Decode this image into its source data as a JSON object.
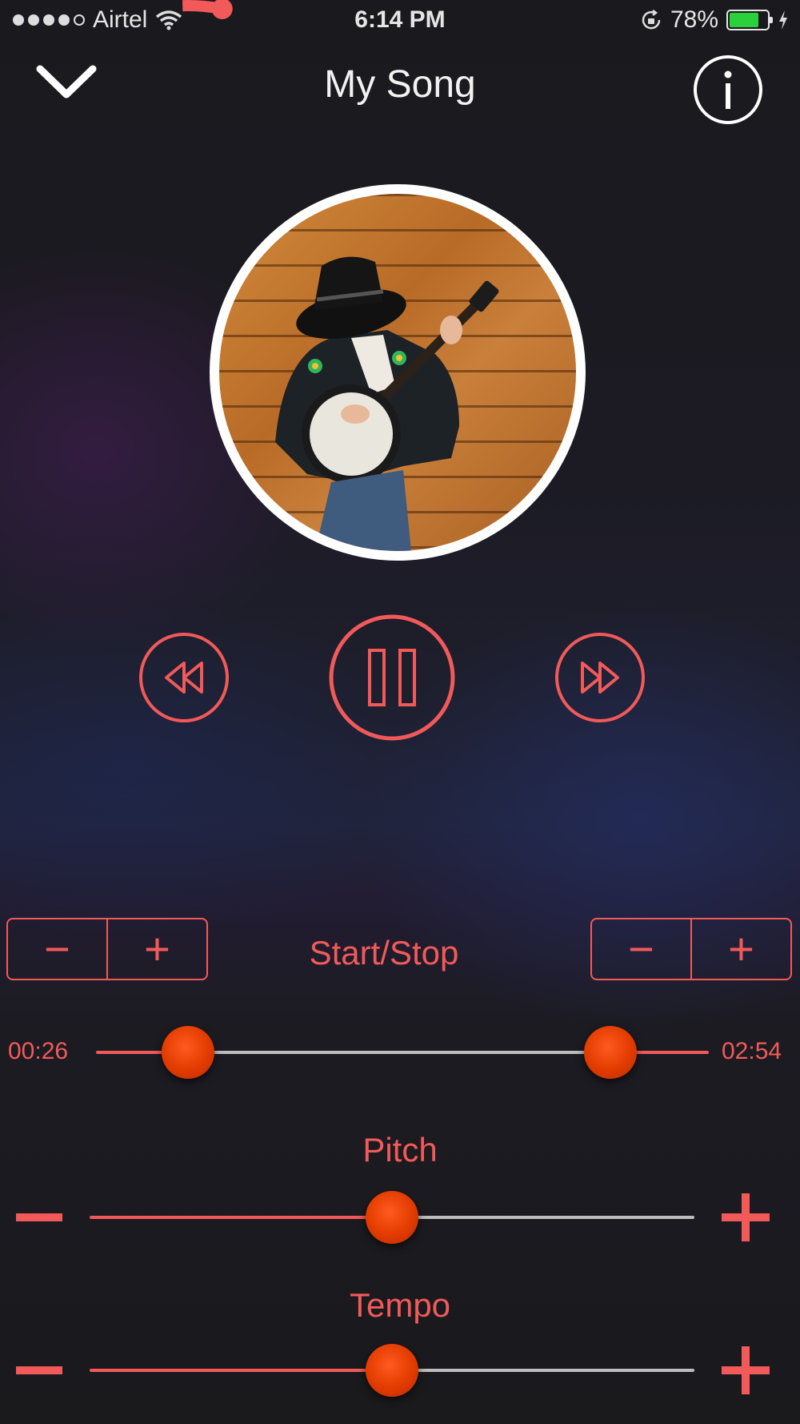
{
  "status_bar": {
    "carrier": "Airtel",
    "time": "6:14 PM",
    "battery_percent": "78%",
    "battery_level": 0.78,
    "signal_bars": 4
  },
  "header": {
    "title": "My Song",
    "collapse_icon": "chevron-down-icon",
    "info_icon": "info-icon"
  },
  "player": {
    "progress": 0.03,
    "controls": {
      "rewind_icon": "rewind-icon",
      "pause_icon": "pause-icon",
      "forward_icon": "fast-forward-icon"
    }
  },
  "loop": {
    "label": "Start/Stop",
    "start_time": "00:26",
    "end_time": "02:54",
    "start_fraction": 0.15,
    "end_fraction": 0.84,
    "left_stepper": {
      "minus": "−",
      "plus": "+"
    },
    "right_stepper": {
      "minus": "−",
      "plus": "+"
    }
  },
  "pitch": {
    "label": "Pitch",
    "value": 0.5
  },
  "tempo": {
    "label": "Tempo",
    "value": 0.5
  },
  "colors": {
    "accent": "#f25a5a",
    "knob": "#e23b00",
    "track_inactive": "#bdbdbd"
  }
}
